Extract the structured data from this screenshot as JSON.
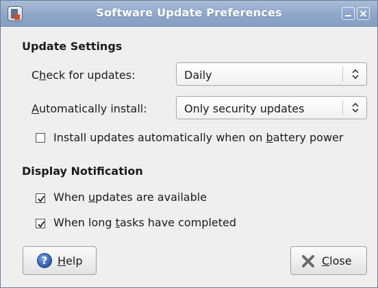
{
  "window": {
    "title": "Software Update Preferences"
  },
  "update_settings": {
    "heading": "Update Settings",
    "check_label": {
      "pre": "C",
      "key": "h",
      "post": "eck for updates:"
    },
    "check_value": "Daily",
    "install_label": {
      "pre": "",
      "key": "A",
      "post": "utomatically install:"
    },
    "install_value": "Only security updates",
    "battery": {
      "pre": "Install updates automatically when on ",
      "key": "b",
      "post": "attery power",
      "checked": false
    }
  },
  "display_notification": {
    "heading": "Display Notification",
    "available": {
      "pre": "When ",
      "key": "u",
      "post": "pdates are available",
      "checked": true
    },
    "tasks": {
      "pre": "When long ",
      "key": "t",
      "post": "asks have completed",
      "checked": true
    }
  },
  "buttons": {
    "help": {
      "key": "H",
      "post": "elp",
      "icon": "help-icon"
    },
    "close": {
      "key": "C",
      "post": "lose",
      "icon": "close-icon"
    }
  }
}
